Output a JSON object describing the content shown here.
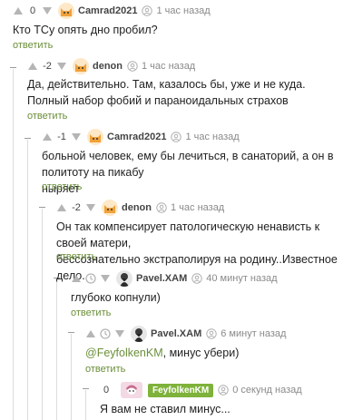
{
  "colors": {
    "accent": "#6b8e3a",
    "badge": "#7fb23a",
    "muted": "#8a8a8a",
    "thread_line": "#dcdcdc"
  },
  "comments": [
    {
      "rating": "0",
      "user": "Camrad2021",
      "time": "1 час назад",
      "text": [
        "Кто ТСу опять дно пробил?"
      ],
      "reply": "ответить",
      "avatar_icon": "cat-avatar-icon"
    },
    {
      "rating": "-2",
      "user": "denon",
      "time": "1 час назад",
      "text": [
        "Да, действительно. Там, казалось бы, уже и не куда.",
        "Полный набор фобий и параноидальных страхов"
      ],
      "reply": "ответить",
      "avatar_icon": "cat-avatar-icon"
    },
    {
      "rating": "-1",
      "user": "Camrad2021",
      "time": "1 час назад",
      "text": [
        "больной человек, ему бы лечиться, в санаторий, а он в политоту на пикабу",
        "ныряет"
      ],
      "reply": "ответить",
      "avatar_icon": "cat-avatar-icon"
    },
    {
      "rating": "-2",
      "user": "denon",
      "time": "1 час назад",
      "text": [
        "Он так компенсирует патологическую ненависть к своей матери,",
        "бессознательно экстраполируя на родину..Известное дело."
      ],
      "reply": "ответить",
      "avatar_icon": "cat-avatar-icon"
    },
    {
      "rating": "",
      "user": "Pavel.XAM",
      "time": "40 минут назад",
      "text": [
        "глубоко копнули)"
      ],
      "reply": "ответить",
      "avatar_icon": "bearded-man-avatar-icon"
    },
    {
      "rating": "",
      "user": "Pavel.XAM",
      "time": "6 минут назад",
      "mention": "@FeyfolkenKM",
      "text_after_mention": ", минус убери)",
      "reply": "ответить",
      "avatar_icon": "bearded-man-avatar-icon"
    },
    {
      "rating": "0",
      "user": "FeyfolkenKM",
      "time": "0 секунд назад",
      "text": [
        "Я вам не ставил минус..."
      ],
      "avatar_icon": "anime-avatar-icon"
    }
  ]
}
